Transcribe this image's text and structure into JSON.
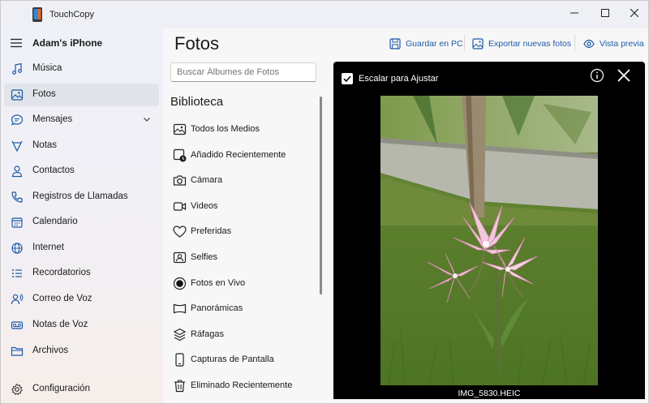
{
  "app": {
    "title": "TouchCopy"
  },
  "window_controls": {
    "minimize": "—",
    "maximize": "□",
    "close": "✕"
  },
  "sidebar": {
    "device_name": "Adam's iPhone",
    "items": [
      {
        "label": "Música",
        "icon": "music-note-icon"
      },
      {
        "label": "Fotos",
        "icon": "photo-icon",
        "active": true
      },
      {
        "label": "Mensajes",
        "icon": "chat-bubble-icon",
        "expandable": true
      },
      {
        "label": "Notas",
        "icon": "notes-icon"
      },
      {
        "label": "Contactos",
        "icon": "person-icon"
      },
      {
        "label": "Registros de Llamadas",
        "icon": "phone-icon"
      },
      {
        "label": "Calendario",
        "icon": "calendar-icon"
      },
      {
        "label": "Internet",
        "icon": "globe-icon"
      },
      {
        "label": "Recordatorios",
        "icon": "list-icon"
      },
      {
        "label": "Correo de Voz",
        "icon": "voicemail-person-icon"
      },
      {
        "label": "Notas de Voz",
        "icon": "voicemail-icon"
      },
      {
        "label": "Archivos",
        "icon": "folder-icon"
      }
    ],
    "settings": {
      "label": "Configuración",
      "icon": "gear-icon"
    }
  },
  "main": {
    "title": "Fotos",
    "toolbar": {
      "save_pc": "Guardar en PC",
      "export_new": "Exportar nuevas fotos",
      "preview": "Vista previa"
    },
    "search": {
      "placeholder": "Buscar Álbumes de Fotos"
    },
    "library": {
      "title": "Biblioteca",
      "albums": [
        {
          "label": "Todos los Medios",
          "icon": "gallery-icon"
        },
        {
          "label": "Añadido Recientemente",
          "icon": "recent-icon"
        },
        {
          "label": "Cámara",
          "icon": "camera-icon"
        },
        {
          "label": "Videos",
          "icon": "video-icon"
        },
        {
          "label": "Preferidas",
          "icon": "heart-icon"
        },
        {
          "label": "Selfies",
          "icon": "selfie-icon"
        },
        {
          "label": "Fotos en Vivo",
          "icon": "live-photo-icon"
        },
        {
          "label": "Panorámicas",
          "icon": "panorama-icon"
        },
        {
          "label": "Ráfagas",
          "icon": "burst-icon"
        },
        {
          "label": "Capturas de Pantalla",
          "icon": "phone-screenshot-icon"
        },
        {
          "label": "Eliminado Recientemente",
          "icon": "trash-icon"
        }
      ]
    },
    "preview": {
      "fit_label": "Escalar para Ajustar",
      "fit_checked": true,
      "filename": "IMG_5830.HEIC"
    }
  },
  "colors": {
    "accent": "#1c5aa8",
    "active_item": "#e1e4ea",
    "preview_bg": "#000000"
  }
}
